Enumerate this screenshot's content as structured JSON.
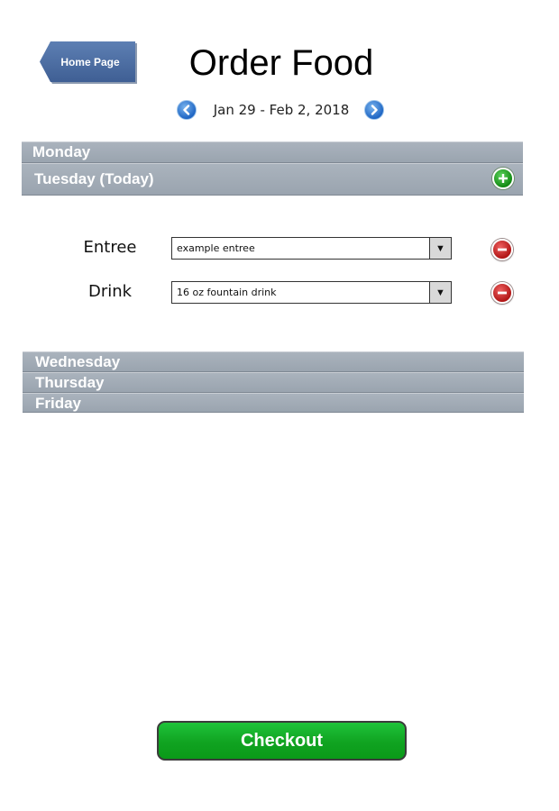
{
  "header": {
    "home_button_label": "Home Page",
    "title": "Order Food"
  },
  "week_nav": {
    "range": "Jan 29 - Feb 2, 2018",
    "prev_icon": "chevron-left-icon",
    "next_icon": "chevron-right-icon"
  },
  "days": {
    "monday": "Monday",
    "tuesday": "Tuesday (Today)",
    "wednesday": "Wednesday",
    "thursday": "Thursday",
    "friday": "Friday"
  },
  "order_items": {
    "entree": {
      "label": "Entree",
      "value": "example entree"
    },
    "drink": {
      "label": "Drink",
      "value": "16 oz fountain drink"
    }
  },
  "icons": {
    "add": "plus-circle-icon",
    "remove": "minus-circle-icon",
    "dropdown": "dropdown-arrow-icon"
  },
  "checkout_label": "Checkout",
  "colors": {
    "home_button": "#4a6ba1",
    "day_bar": "#a1aab5",
    "checkout": "#12a826",
    "add_icon": "#1a9a1a",
    "remove_icon": "#c41e1e",
    "nav_icon": "#2a75d0"
  }
}
